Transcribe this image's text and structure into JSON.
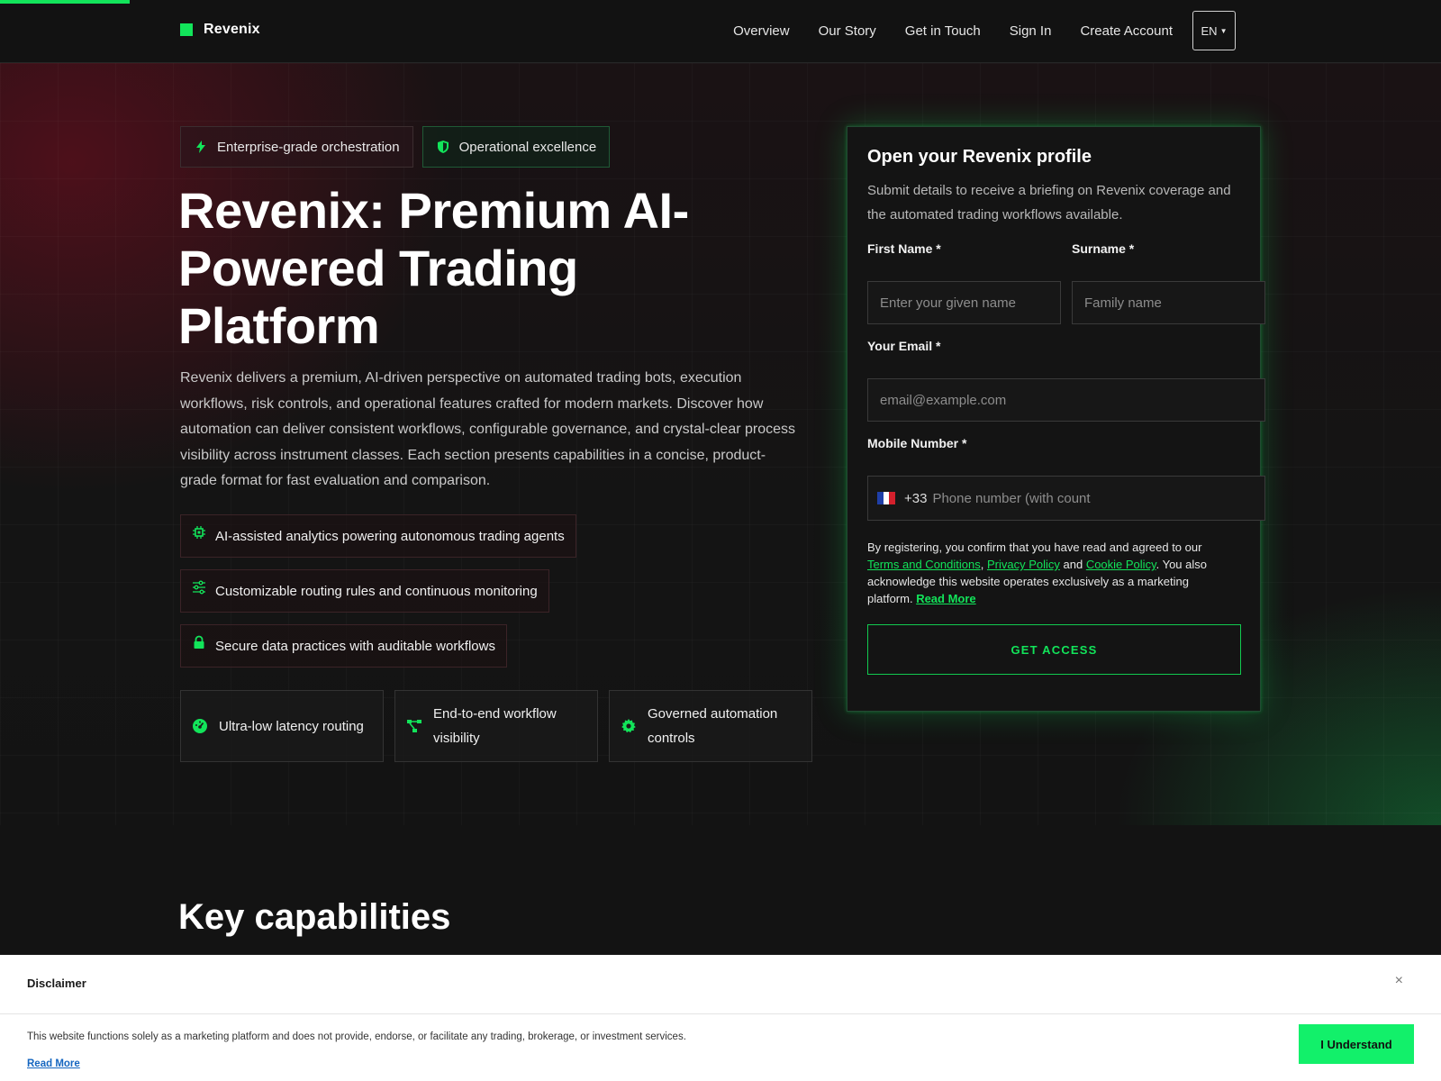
{
  "brand": {
    "name": "Revenix",
    "accent": "#12e45a"
  },
  "nav": {
    "items": [
      "Overview",
      "Our Story",
      "Get in Touch",
      "Sign In",
      "Create Account"
    ],
    "lang": "EN"
  },
  "hero": {
    "badges": [
      "Enterprise-grade orchestration",
      "Operational excellence"
    ],
    "title": "Revenix: Premium AI-Powered Trading Platform",
    "description": "Revenix delivers a premium, AI-driven perspective on automated trading bots, execution workflows, risk controls, and operational features crafted for modern markets. Discover how automation can deliver consistent workflows, configurable governance, and crystal-clear process visibility across instrument classes. Each section presents capabilities in a concise, product-grade format for fast evaluation and comparison.",
    "features": [
      {
        "icon": "chip-icon",
        "label": "AI-assisted analytics powering autonomous trading agents"
      },
      {
        "icon": "sliders-icon",
        "label": "Customizable routing rules and continuous monitoring"
      },
      {
        "icon": "lock-icon",
        "label": "Secure data practices with auditable workflows"
      }
    ],
    "cards": [
      {
        "icon": "gauge-icon",
        "label": "Ultra-low latency routing"
      },
      {
        "icon": "workflow-icon",
        "label": "End-to-end workflow visibility"
      },
      {
        "icon": "gear-icon",
        "label": "Governed automation controls"
      }
    ]
  },
  "form": {
    "title": "Open your Revenix profile",
    "subtitle": "Submit details to receive a briefing on Revenix coverage and the automated trading workflows available.",
    "first_name": {
      "label": "First Name *",
      "placeholder": "Enter your given name"
    },
    "surname": {
      "label": "Surname *",
      "placeholder": "Family name"
    },
    "email": {
      "label": "Your Email *",
      "placeholder": "email@example.com"
    },
    "phone": {
      "label": "Mobile Number *",
      "dial": "+33",
      "placeholder": "Phone number (with count"
    },
    "consent": {
      "prefix": "By registering, you confirm that you have read and agreed to our ",
      "terms": "Terms and Conditions",
      "comma": ", ",
      "privacy": "Privacy Policy",
      "and": " and ",
      "cookie": "Cookie Policy",
      "suffix": ". You also acknowledge this website operates exclusively as a marketing platform. ",
      "read_more": "Read More"
    },
    "submit": "GET ACCESS"
  },
  "section": {
    "title": "Key capabilities"
  },
  "disclaimer": {
    "title": "Disclaimer",
    "close": "×",
    "text": "This website functions solely as a marketing platform and does not provide, endorse, or facilitate any trading, brokerage, or investment services.",
    "read_more": "Read More",
    "button": "I Understand"
  }
}
